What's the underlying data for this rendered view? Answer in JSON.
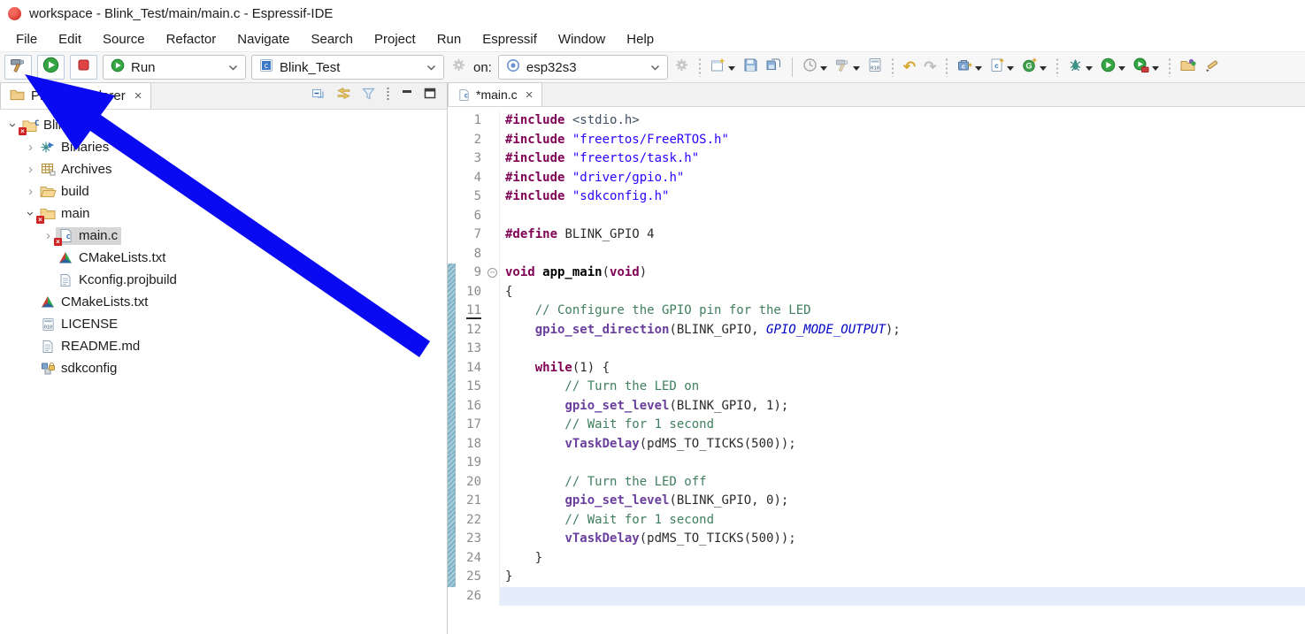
{
  "window": {
    "title": "workspace - Blink_Test/main/main.c - Espressif-IDE"
  },
  "menu_bar": {
    "items": [
      "File",
      "Edit",
      "Source",
      "Refactor",
      "Navigate",
      "Search",
      "Project",
      "Run",
      "Espressif",
      "Window",
      "Help"
    ]
  },
  "toolbar": {
    "build_button": "build",
    "run_button": "run",
    "stop_button": "stop",
    "run_combo_label": "Run",
    "project_combo_label": "Blink_Test",
    "on_label": "on:",
    "target_combo_label": "esp32s3",
    "icon_strip": [
      {
        "type": "dotsep"
      },
      {
        "type": "icon",
        "name": "new-wizard",
        "dropdown": true
      },
      {
        "type": "icon",
        "name": "save"
      },
      {
        "type": "icon",
        "name": "save-all"
      },
      {
        "type": "sep"
      },
      {
        "type": "icon",
        "name": "clock",
        "dropdown": true
      },
      {
        "type": "icon",
        "name": "build-hammer",
        "dropdown": true
      },
      {
        "type": "icon",
        "name": "binary-file"
      },
      {
        "type": "dotsep"
      },
      {
        "type": "icon",
        "name": "undo"
      },
      {
        "type": "icon",
        "name": "redo"
      },
      {
        "type": "dotsep"
      },
      {
        "type": "icon",
        "name": "new-c-project",
        "dropdown": true
      },
      {
        "type": "icon",
        "name": "new-source-file",
        "dropdown": true
      },
      {
        "type": "icon",
        "name": "new-class",
        "dropdown": true
      },
      {
        "type": "dotsep"
      },
      {
        "type": "icon",
        "name": "debug",
        "dropdown": true
      },
      {
        "type": "icon",
        "name": "run",
        "dropdown": true
      },
      {
        "type": "icon",
        "name": "profile",
        "dropdown": true
      },
      {
        "type": "dotsep"
      },
      {
        "type": "icon",
        "name": "open-element"
      },
      {
        "type": "icon",
        "name": "last-edit-location"
      }
    ]
  },
  "project_explorer": {
    "tab_label": "Project Explorer",
    "close_glyph": "×",
    "toolbar_icons": [
      "collapse-all",
      "link-with-editor",
      "filter",
      "view-menu",
      "minimize",
      "maximize"
    ],
    "tree": [
      {
        "level": 0,
        "expander": "expanded",
        "icon": "c-project",
        "label": "Blink_Test",
        "error": true
      },
      {
        "level": 1,
        "expander": "collapsed",
        "icon": "binaries",
        "label": "Binaries"
      },
      {
        "level": 1,
        "expander": "collapsed",
        "icon": "archives",
        "label": "Archives"
      },
      {
        "level": 1,
        "expander": "collapsed",
        "icon": "folder-open",
        "label": "build"
      },
      {
        "level": 1,
        "expander": "expanded",
        "icon": "folder-closed",
        "label": "main",
        "error": true
      },
      {
        "level": 2,
        "expander": "collapsed",
        "icon": "c-file",
        "label": "main.c",
        "selected": true,
        "error": true
      },
      {
        "level": 2,
        "expander": null,
        "icon": "cmake",
        "label": "CMakeLists.txt"
      },
      {
        "level": 2,
        "expander": null,
        "icon": "text-file",
        "label": "Kconfig.projbuild"
      },
      {
        "level": 1,
        "expander": null,
        "icon": "cmake",
        "label": "CMakeLists.txt"
      },
      {
        "level": 1,
        "expander": null,
        "icon": "binary-doc",
        "label": "LICENSE"
      },
      {
        "level": 1,
        "expander": null,
        "icon": "text-file",
        "label": "README.md"
      },
      {
        "level": 1,
        "expander": null,
        "icon": "sdkconfig",
        "label": "sdkconfig"
      }
    ]
  },
  "editor": {
    "tab_label": "*main.c",
    "close_glyph": "×",
    "current_line": 26,
    "fold_marker_line": 9,
    "underlined_number_line": 11,
    "changed_range": {
      "from": 9,
      "to": 25
    },
    "code_lines": [
      {
        "n": 1,
        "tokens": [
          [
            "kw",
            "#include"
          ],
          [
            "pl",
            " "
          ],
          [
            "hdr",
            "<stdio.h>"
          ]
        ]
      },
      {
        "n": 2,
        "tokens": [
          [
            "kw",
            "#include"
          ],
          [
            "pl",
            " "
          ],
          [
            "str",
            "\"freertos/FreeRTOS.h\""
          ]
        ]
      },
      {
        "n": 3,
        "tokens": [
          [
            "kw",
            "#include"
          ],
          [
            "pl",
            " "
          ],
          [
            "str",
            "\"freertos/task.h\""
          ]
        ]
      },
      {
        "n": 4,
        "tokens": [
          [
            "kw",
            "#include"
          ],
          [
            "pl",
            " "
          ],
          [
            "str",
            "\"driver/gpio.h\""
          ]
        ]
      },
      {
        "n": 5,
        "tokens": [
          [
            "kw",
            "#include"
          ],
          [
            "pl",
            " "
          ],
          [
            "str",
            "\"sdkconfig.h\""
          ]
        ]
      },
      {
        "n": 6,
        "tokens": []
      },
      {
        "n": 7,
        "tokens": [
          [
            "kw",
            "#define"
          ],
          [
            "pl",
            " BLINK_GPIO 4"
          ]
        ]
      },
      {
        "n": 8,
        "tokens": []
      },
      {
        "n": 9,
        "tokens": [
          [
            "kw",
            "void"
          ],
          [
            "fndecl",
            " app_main"
          ],
          [
            "pl",
            "("
          ],
          [
            "kw",
            "void"
          ],
          [
            "pl",
            ")"
          ]
        ]
      },
      {
        "n": 10,
        "tokens": [
          [
            "pl",
            "{"
          ]
        ]
      },
      {
        "n": 11,
        "tokens": [
          [
            "cm",
            "    // Configure the GPIO pin for the LED"
          ]
        ]
      },
      {
        "n": 12,
        "tokens": [
          [
            "pl",
            "    "
          ],
          [
            "fn",
            "gpio_set_direction"
          ],
          [
            "pl",
            "(BLINK_GPIO, "
          ],
          [
            "en",
            "GPIO_MODE_OUTPUT"
          ],
          [
            "pl",
            ");"
          ]
        ]
      },
      {
        "n": 13,
        "tokens": []
      },
      {
        "n": 14,
        "tokens": [
          [
            "pl",
            "    "
          ],
          [
            "kw",
            "while"
          ],
          [
            "pl",
            "(1) {"
          ]
        ]
      },
      {
        "n": 15,
        "tokens": [
          [
            "cm",
            "        // Turn the LED on"
          ]
        ]
      },
      {
        "n": 16,
        "tokens": [
          [
            "pl",
            "        "
          ],
          [
            "fn",
            "gpio_set_level"
          ],
          [
            "pl",
            "(BLINK_GPIO, 1);"
          ]
        ]
      },
      {
        "n": 17,
        "tokens": [
          [
            "cm",
            "        // Wait for 1 second"
          ]
        ]
      },
      {
        "n": 18,
        "tokens": [
          [
            "pl",
            "        "
          ],
          [
            "fn",
            "vTaskDelay"
          ],
          [
            "pl",
            "(pdMS_TO_TICKS(500));"
          ]
        ]
      },
      {
        "n": 19,
        "tokens": []
      },
      {
        "n": 20,
        "tokens": [
          [
            "cm",
            "        // Turn the LED off"
          ]
        ]
      },
      {
        "n": 21,
        "tokens": [
          [
            "pl",
            "        "
          ],
          [
            "fn",
            "gpio_set_level"
          ],
          [
            "pl",
            "(BLINK_GPIO, 0);"
          ]
        ]
      },
      {
        "n": 22,
        "tokens": [
          [
            "cm",
            "        // Wait for 1 second"
          ]
        ]
      },
      {
        "n": 23,
        "tokens": [
          [
            "pl",
            "        "
          ],
          [
            "fn",
            "vTaskDelay"
          ],
          [
            "pl",
            "(pdMS_TO_TICKS(500));"
          ]
        ]
      },
      {
        "n": 24,
        "tokens": [
          [
            "pl",
            "    }"
          ]
        ]
      },
      {
        "n": 25,
        "tokens": [
          [
            "pl",
            "}"
          ]
        ]
      },
      {
        "n": 26,
        "tokens": []
      }
    ]
  },
  "annotation": {
    "type": "arrow",
    "color": "#0a0af2",
    "points_at": "build-hammer-button"
  }
}
